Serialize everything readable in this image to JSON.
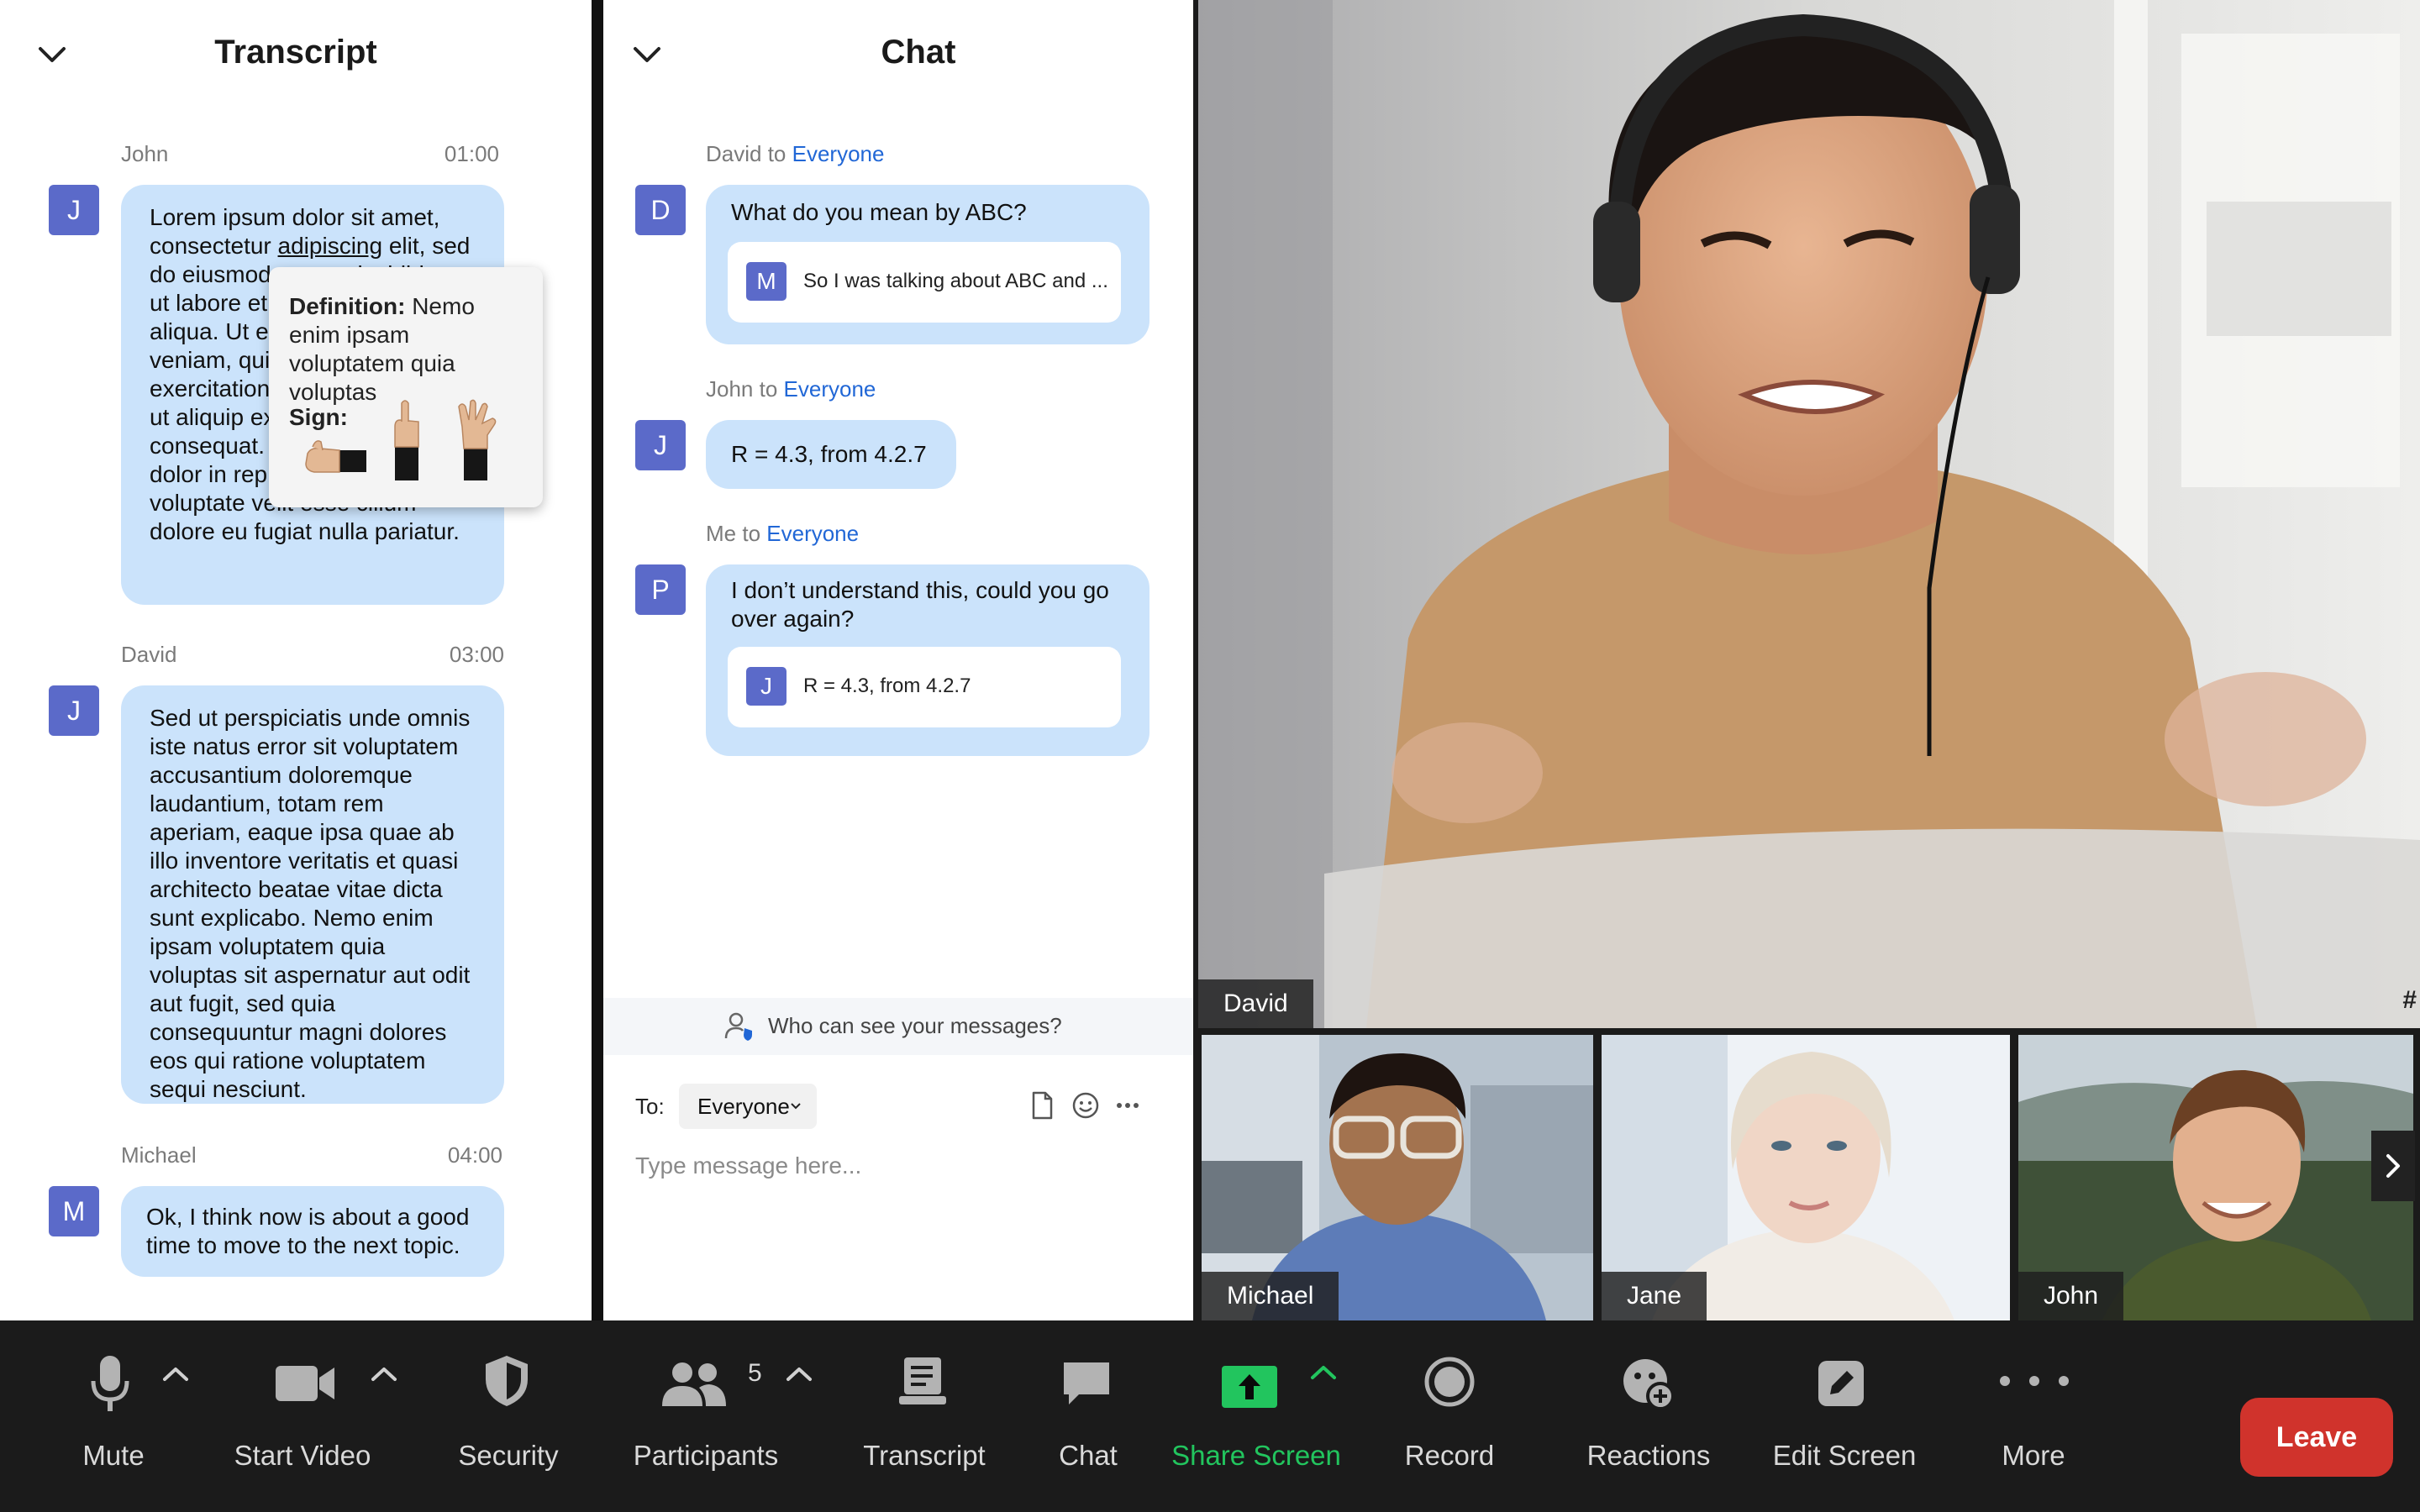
{
  "transcript": {
    "title": "Transcript",
    "entries": [
      {
        "speaker": "John",
        "time": "01:00",
        "avatar": "J",
        "text_before": "Lorem ipsum dolor sit amet, consectetur ",
        "highlight": "adipiscing",
        "text_after": " elit, sed do eiusmod tempor incididunt ut labore et dolore magna aliqua. Ut enim ad minim veniam, quis nostrud exercitation ullamco laboris nisi ut aliquip ex ea commodo consequat. Duis aute irure dolor in reprehenderit in voluptate velit esse cillum dolore eu fugiat nulla pariatur."
      },
      {
        "speaker": "David",
        "time": "03:00",
        "avatar": "J",
        "text": "Sed ut perspiciatis unde omnis iste natus error sit voluptatem accusantium doloremque laudantium, totam rem aperiam, eaque ipsa quae ab illo inventore veritatis et quasi architecto beatae vitae dicta sunt explicabo. Nemo enim ipsam voluptatem quia voluptas sit aspernatur aut odit aut fugit, sed quia consequuntur magni dolores eos qui ratione voluptatem sequi nesciunt."
      },
      {
        "speaker": "Michael",
        "time": "04:00",
        "avatar": "M",
        "text": "Ok, I think now is about a good time to move to the next topic."
      }
    ],
    "definition_popup": {
      "definition_label": "Definition:",
      "definition_text": " Nemo enim ipsam voluptatem quia voluptas",
      "sign_label": "Sign:"
    }
  },
  "chat": {
    "title": "Chat",
    "messages": [
      {
        "sender": "David",
        "to_word": " to ",
        "recipient": "Everyone",
        "avatar": "D",
        "text": "What do you mean by ABC?",
        "quote": {
          "avatar": "M",
          "text": "So I was talking about ABC and ..."
        }
      },
      {
        "sender": "John",
        "to_word": " to ",
        "recipient": "Everyone",
        "avatar": "J",
        "text": "R = 4.3, from 4.2.7"
      },
      {
        "sender": "Me",
        "to_word": " to ",
        "recipient": "Everyone",
        "avatar": "P",
        "text": "I don’t understand this, could you go over again?",
        "quote": {
          "avatar": "J",
          "text": "R = 4.3, from 4.2.7"
        }
      }
    ],
    "visibility_text": "Who can see your messages?",
    "to_label": "To:",
    "to_value": "Everyone",
    "input_placeholder": "Type message here..."
  },
  "video": {
    "main": {
      "name": "David",
      "corner_mark": "#"
    },
    "thumbnails": [
      {
        "name": "Michael"
      },
      {
        "name": "Jane"
      },
      {
        "name": "John"
      }
    ]
  },
  "toolbar": {
    "mute": "Mute",
    "start_video": "Start Video",
    "security": "Security",
    "participants": "Participants",
    "participants_count": "5",
    "transcript": "Transcript",
    "chat": "Chat",
    "share_screen": "Share Screen",
    "record": "Record",
    "reactions": "Reactions",
    "edit_screen": "Edit Screen",
    "more": "More",
    "leave": "Leave"
  },
  "colors": {
    "accent_blue": "#2167d6",
    "avatar": "#5b6ac9",
    "bubble": "#cbe3fb",
    "share_green": "#22c55e",
    "leave_red": "#d0332c",
    "toolbar_bg": "#1b1b1b"
  }
}
